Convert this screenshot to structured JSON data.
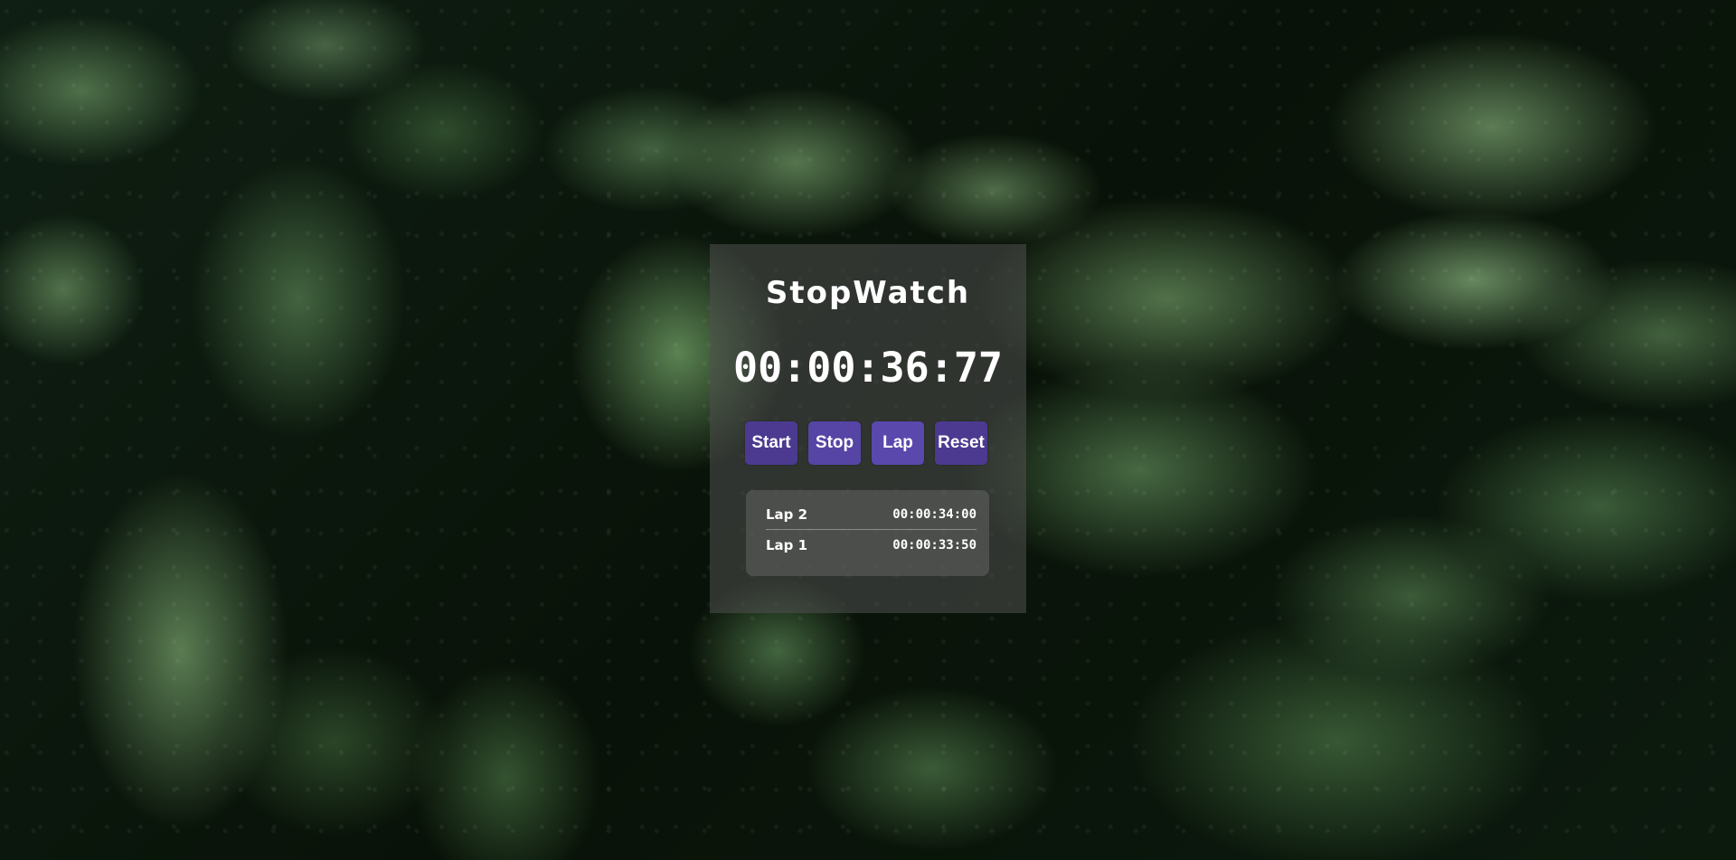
{
  "app": {
    "title": "StopWatch",
    "time": "00:00:36:77"
  },
  "controls": {
    "start_label": "Start",
    "stop_label": "Stop",
    "lap_label": "Lap",
    "reset_label": "Reset"
  },
  "laps": [
    {
      "name": "Lap 2",
      "time": "00:00:34:00"
    },
    {
      "name": "Lap 1",
      "time": "00:00:33:50"
    }
  ],
  "colors": {
    "button_accent": "#4e3d96",
    "text": "#ffffff"
  }
}
